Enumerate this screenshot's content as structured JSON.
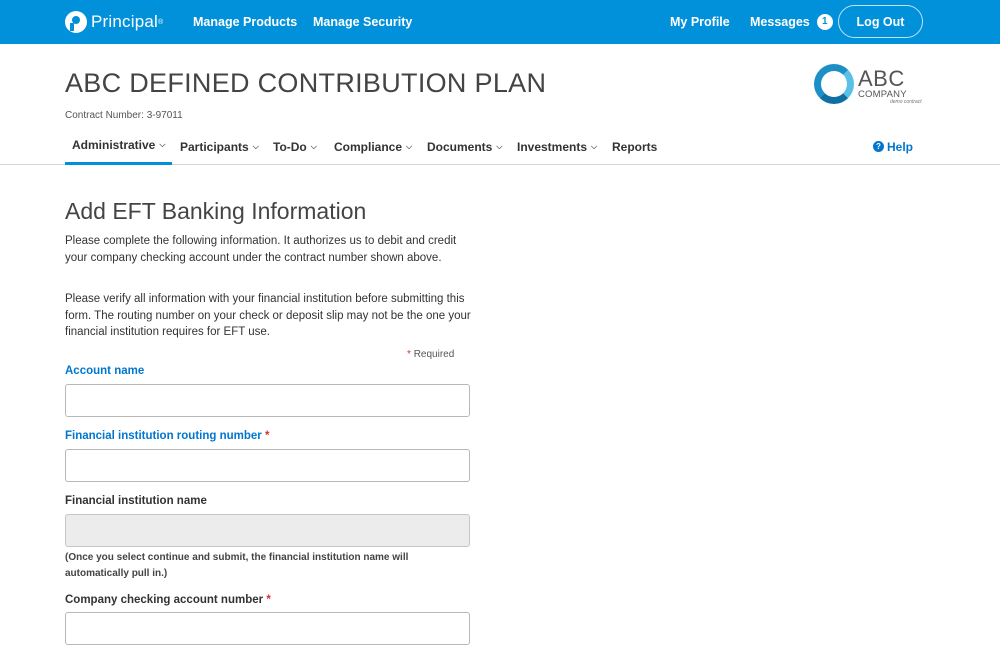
{
  "topbar": {
    "brand_name": "Principal",
    "brand_mark": "®",
    "nav_manage_products": "Manage Products",
    "nav_manage_security": "Manage Security",
    "my_profile": "My Profile",
    "messages": "Messages",
    "messages_count": "1",
    "logout": "Log Out",
    "background_color": "#0091da"
  },
  "header": {
    "plan_title": "ABC DEFINED CONTRIBUTION PLAN",
    "contract_number": "Contract Number: 3-97011",
    "company_logo": {
      "text": "ABC",
      "subtext": "COMPANY",
      "tiny": "demo contract"
    }
  },
  "subnav": {
    "items": [
      {
        "label": "Administrative",
        "active": true
      },
      {
        "label": "Participants"
      },
      {
        "label": "To-Do"
      },
      {
        "label": "Compliance"
      },
      {
        "label": "Documents"
      },
      {
        "label": "Investments"
      },
      {
        "label": "Reports"
      }
    ],
    "help": "Help",
    "chevron_icon": "chevron-down-icon",
    "accent_color": "#0091da"
  },
  "form": {
    "title": "Add EFT Banking Information",
    "intro_1": "Please complete the following information. It authorizes us to debit and credit your company checking account under the contract number shown above.",
    "intro_2": "Please verify all information with your financial institution before submitting this form. The routing number on your check or deposit slip may not be the one your financial institution requires for EFT use.",
    "required_star": "*",
    "required_text": "Required",
    "fields": [
      {
        "label": "Account name",
        "value": "",
        "required": false
      },
      {
        "label": "Financial institution routing number",
        "value": "",
        "required": true
      },
      {
        "label": "Financial institution name",
        "value": "",
        "disabled": true,
        "help": "(Once you select continue and submit, the financial institution name will automatically pull in.)"
      },
      {
        "label": "Company checking account number",
        "value": "",
        "required": true
      }
    ]
  }
}
